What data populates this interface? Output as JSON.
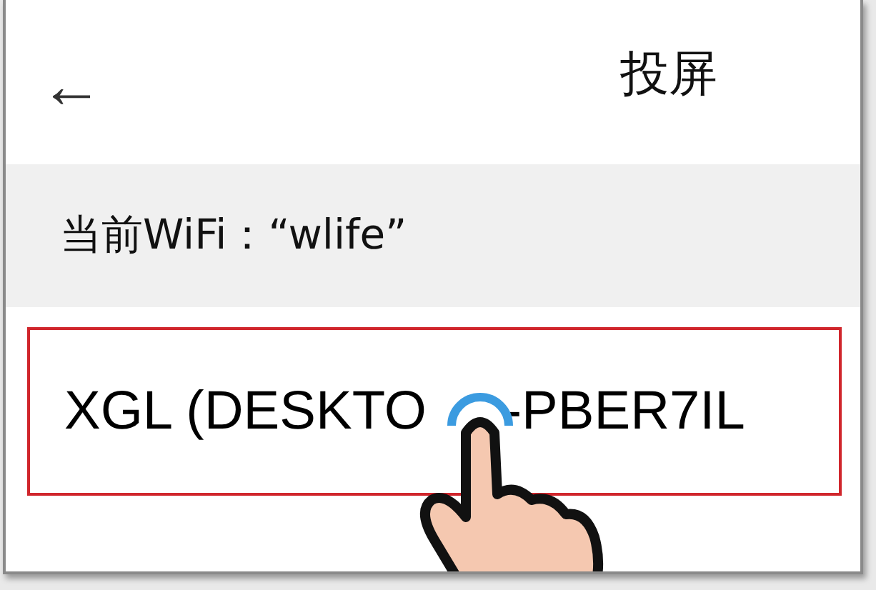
{
  "header": {
    "back": "←",
    "title": "投屏"
  },
  "wifi_label": "当前WiFi：“wlife”",
  "device": {
    "selected": true,
    "name_parts": [
      "XGL (DESKTO",
      "-PBER7IL"
    ]
  }
}
